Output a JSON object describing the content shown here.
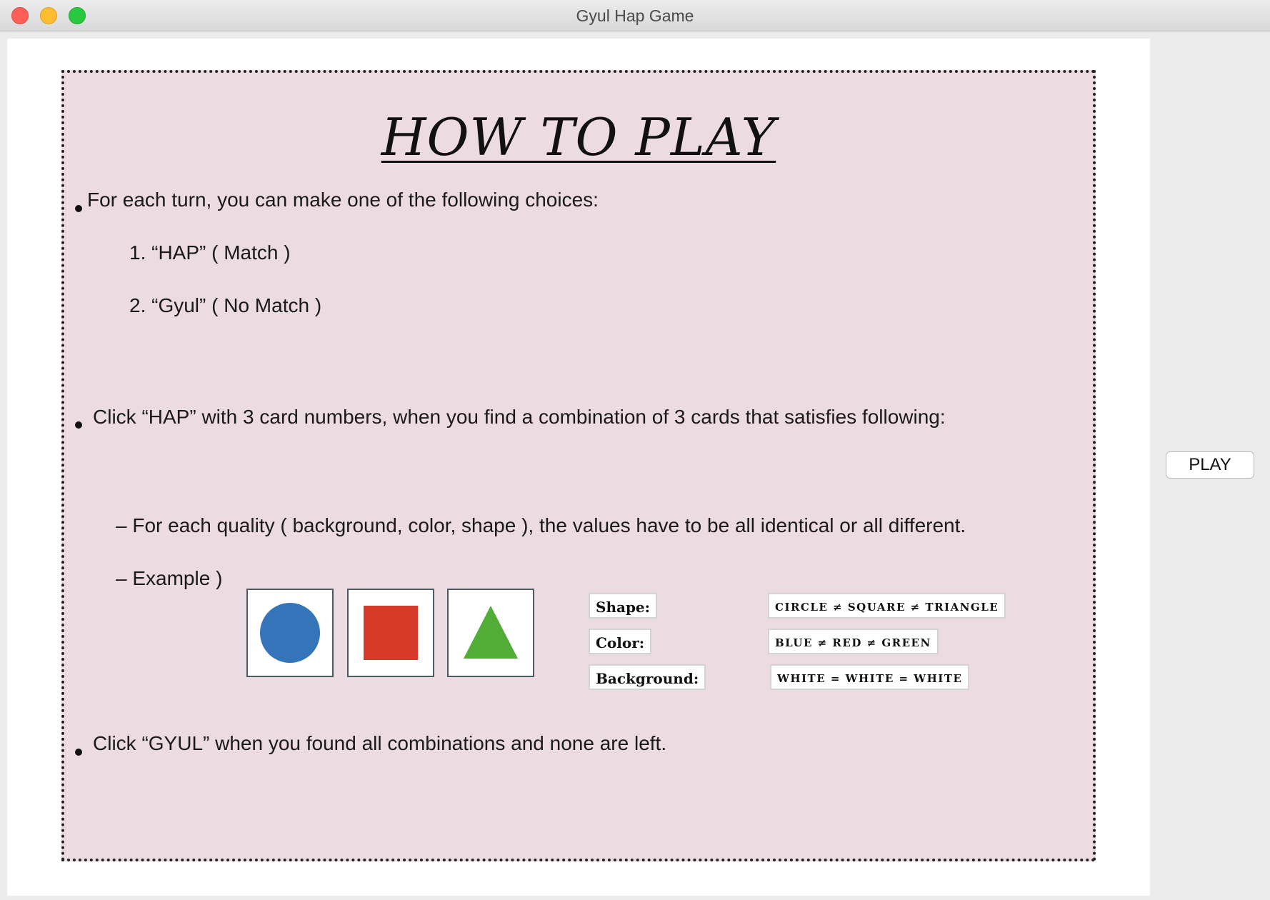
{
  "window": {
    "title": "Gyul Hap Game"
  },
  "rules": {
    "heading": "HOW TO PLAY",
    "intro": "For each turn, you can make one of the following choices:",
    "choice_1": "1. “HAP” ( Match )",
    "choice_2": "2. “Gyul” ( No Match )",
    "hap_rule": "Click “HAP” with 3 card numbers, when you find a combination of 3 cards that satisfies following:",
    "quality_rule": "– For each quality ( background, color, shape ), the values have to be all identical or all different.",
    "example_label": "– Example )",
    "gyul_rule": "Click “GYUL” when you found all combinations and none are left."
  },
  "example": {
    "cards": [
      {
        "shape": "circle",
        "color": "#3474b9",
        "background": "white"
      },
      {
        "shape": "square",
        "color": "#d83a2a",
        "background": "white"
      },
      {
        "shape": "triangle",
        "color": "#52ad36",
        "background": "white"
      }
    ],
    "attributes": [
      {
        "key": "Shape:",
        "value": "circle ≠ square ≠ triangle"
      },
      {
        "key": "Color:",
        "value": "blue ≠ red ≠ green"
      },
      {
        "key": "Background:",
        "value": "white = white = white"
      }
    ]
  },
  "actions": {
    "play_label": "PLAY"
  }
}
